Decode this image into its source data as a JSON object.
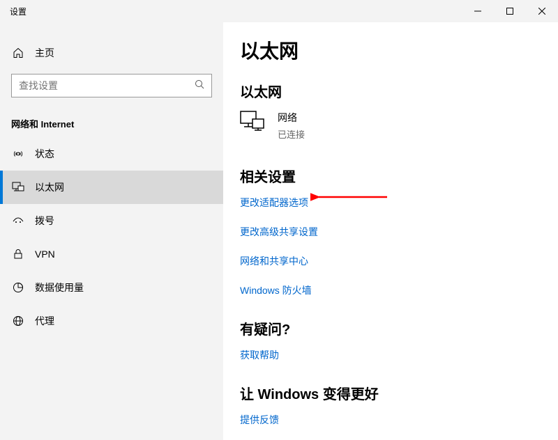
{
  "window": {
    "title": "设置"
  },
  "sidebar": {
    "home": "主页",
    "search_placeholder": "查找设置",
    "section": "网络和 Internet",
    "items": [
      {
        "label": "状态"
      },
      {
        "label": "以太网"
      },
      {
        "label": "拨号"
      },
      {
        "label": "VPN"
      },
      {
        "label": "数据使用量"
      },
      {
        "label": "代理"
      }
    ]
  },
  "main": {
    "page_title": "以太网",
    "network_section": "以太网",
    "network": {
      "name": "网络",
      "status": "已连接"
    },
    "related_heading": "相关设置",
    "related_links": [
      "更改适配器选项",
      "更改高级共享设置",
      "网络和共享中心",
      "Windows 防火墙"
    ],
    "question_heading": "有疑问?",
    "help_link": "获取帮助",
    "better_heading": "让 Windows 变得更好",
    "feedback_link": "提供反馈"
  }
}
